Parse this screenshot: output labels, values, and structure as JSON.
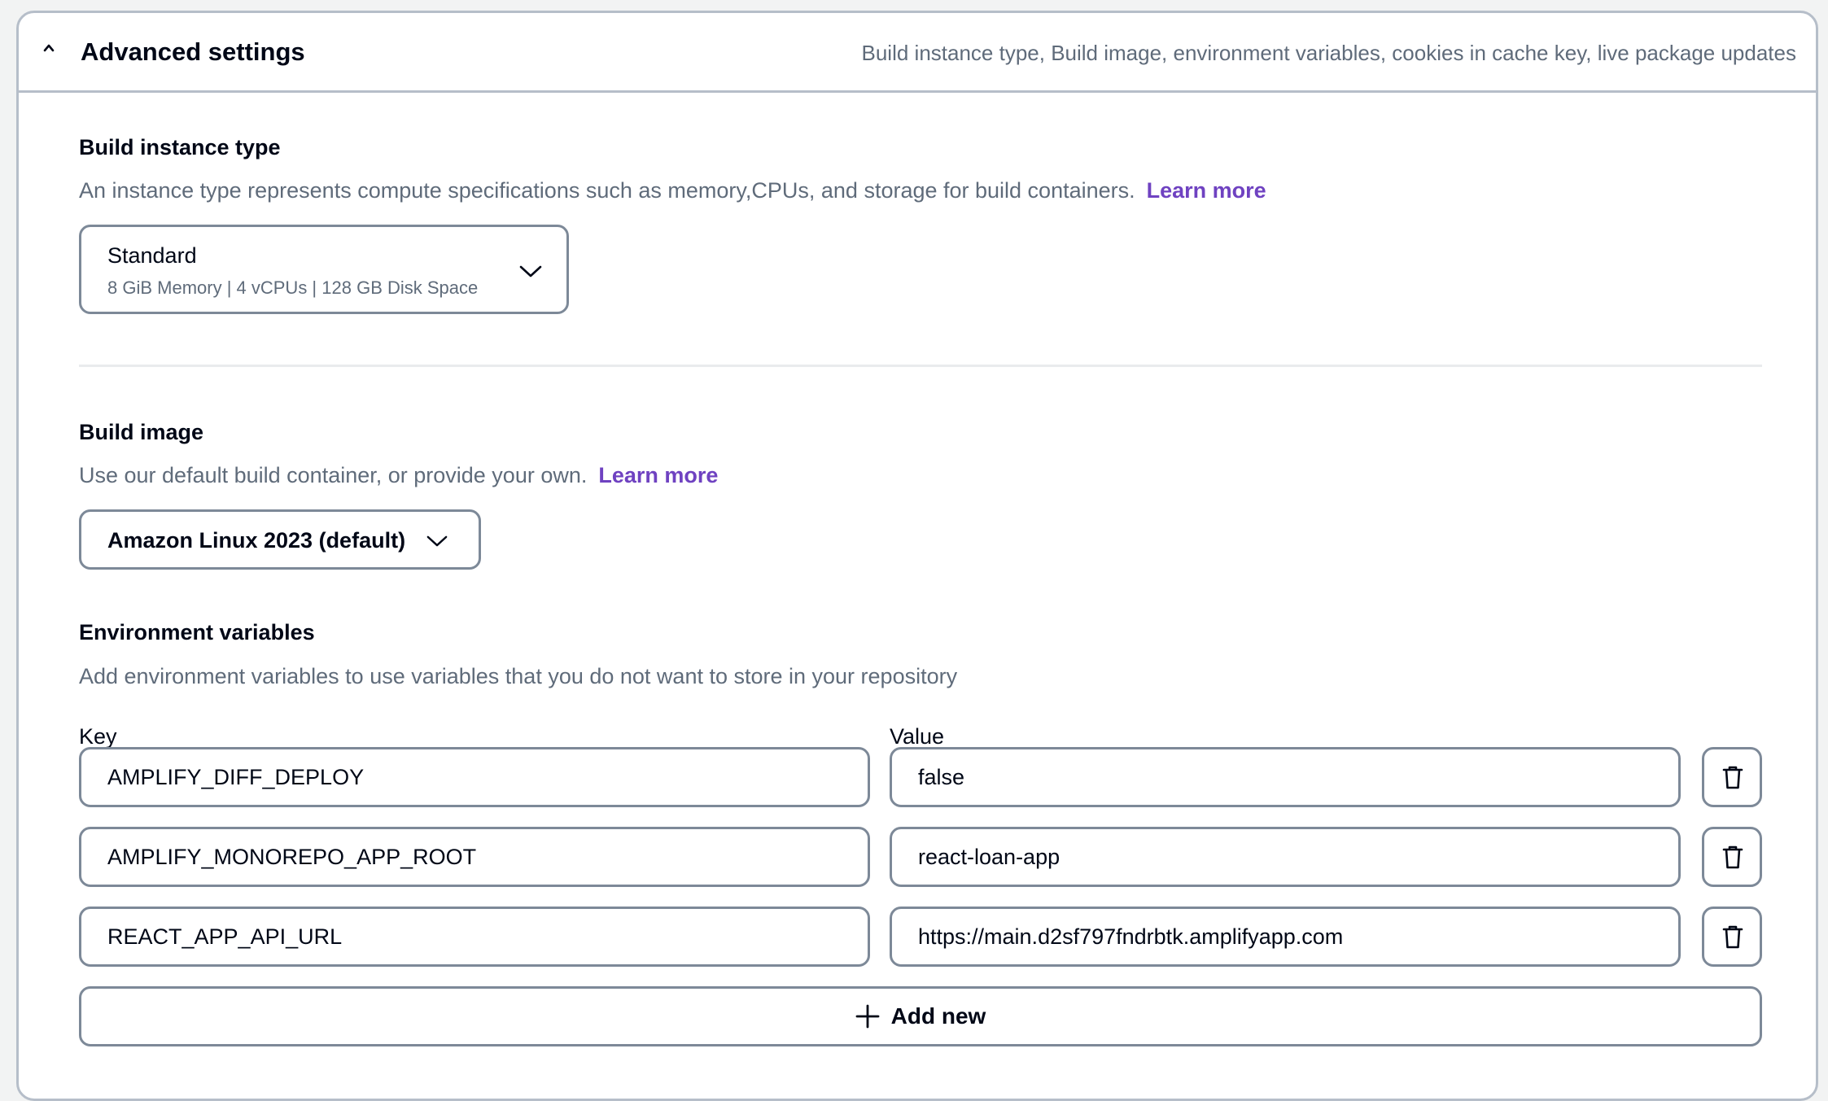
{
  "header": {
    "title": "Advanced settings",
    "description": "Build instance type, Build image, environment variables, cookies in cache key, live package updates"
  },
  "build_instance": {
    "title": "Build instance type",
    "description": "An instance type represents compute specifications such as memory,CPUs, and storage for build containers.",
    "learn_more": "Learn more",
    "selected": "Standard",
    "selected_detail": "8 GiB Memory | 4 vCPUs | 128 GB Disk Space"
  },
  "build_image": {
    "title": "Build image",
    "description": "Use our default build container, or provide your own.",
    "learn_more": "Learn more",
    "selected": "Amazon Linux 2023 (default)"
  },
  "env_vars": {
    "title": "Environment variables",
    "description": "Add environment variables to use variables that you do not want to store in your repository",
    "key_label": "Key",
    "value_label": "Value",
    "rows": [
      {
        "key": "AMPLIFY_DIFF_DEPLOY",
        "value": "false"
      },
      {
        "key": "AMPLIFY_MONOREPO_APP_ROOT",
        "value": "react-loan-app"
      },
      {
        "key": "REACT_APP_API_URL",
        "value": "https://main.d2sf797fndrbtk.amplifyapp.com"
      }
    ],
    "add_label": "Add new"
  },
  "colors": {
    "link": "#6f42c1",
    "border": "#7d8998",
    "muted_text": "#5f6b7a",
    "text": "#000716"
  },
  "icons": {
    "collapse": "caret-up-icon",
    "dropdown": "chevron-down-icon",
    "delete": "trash-icon",
    "add": "plus-icon"
  }
}
